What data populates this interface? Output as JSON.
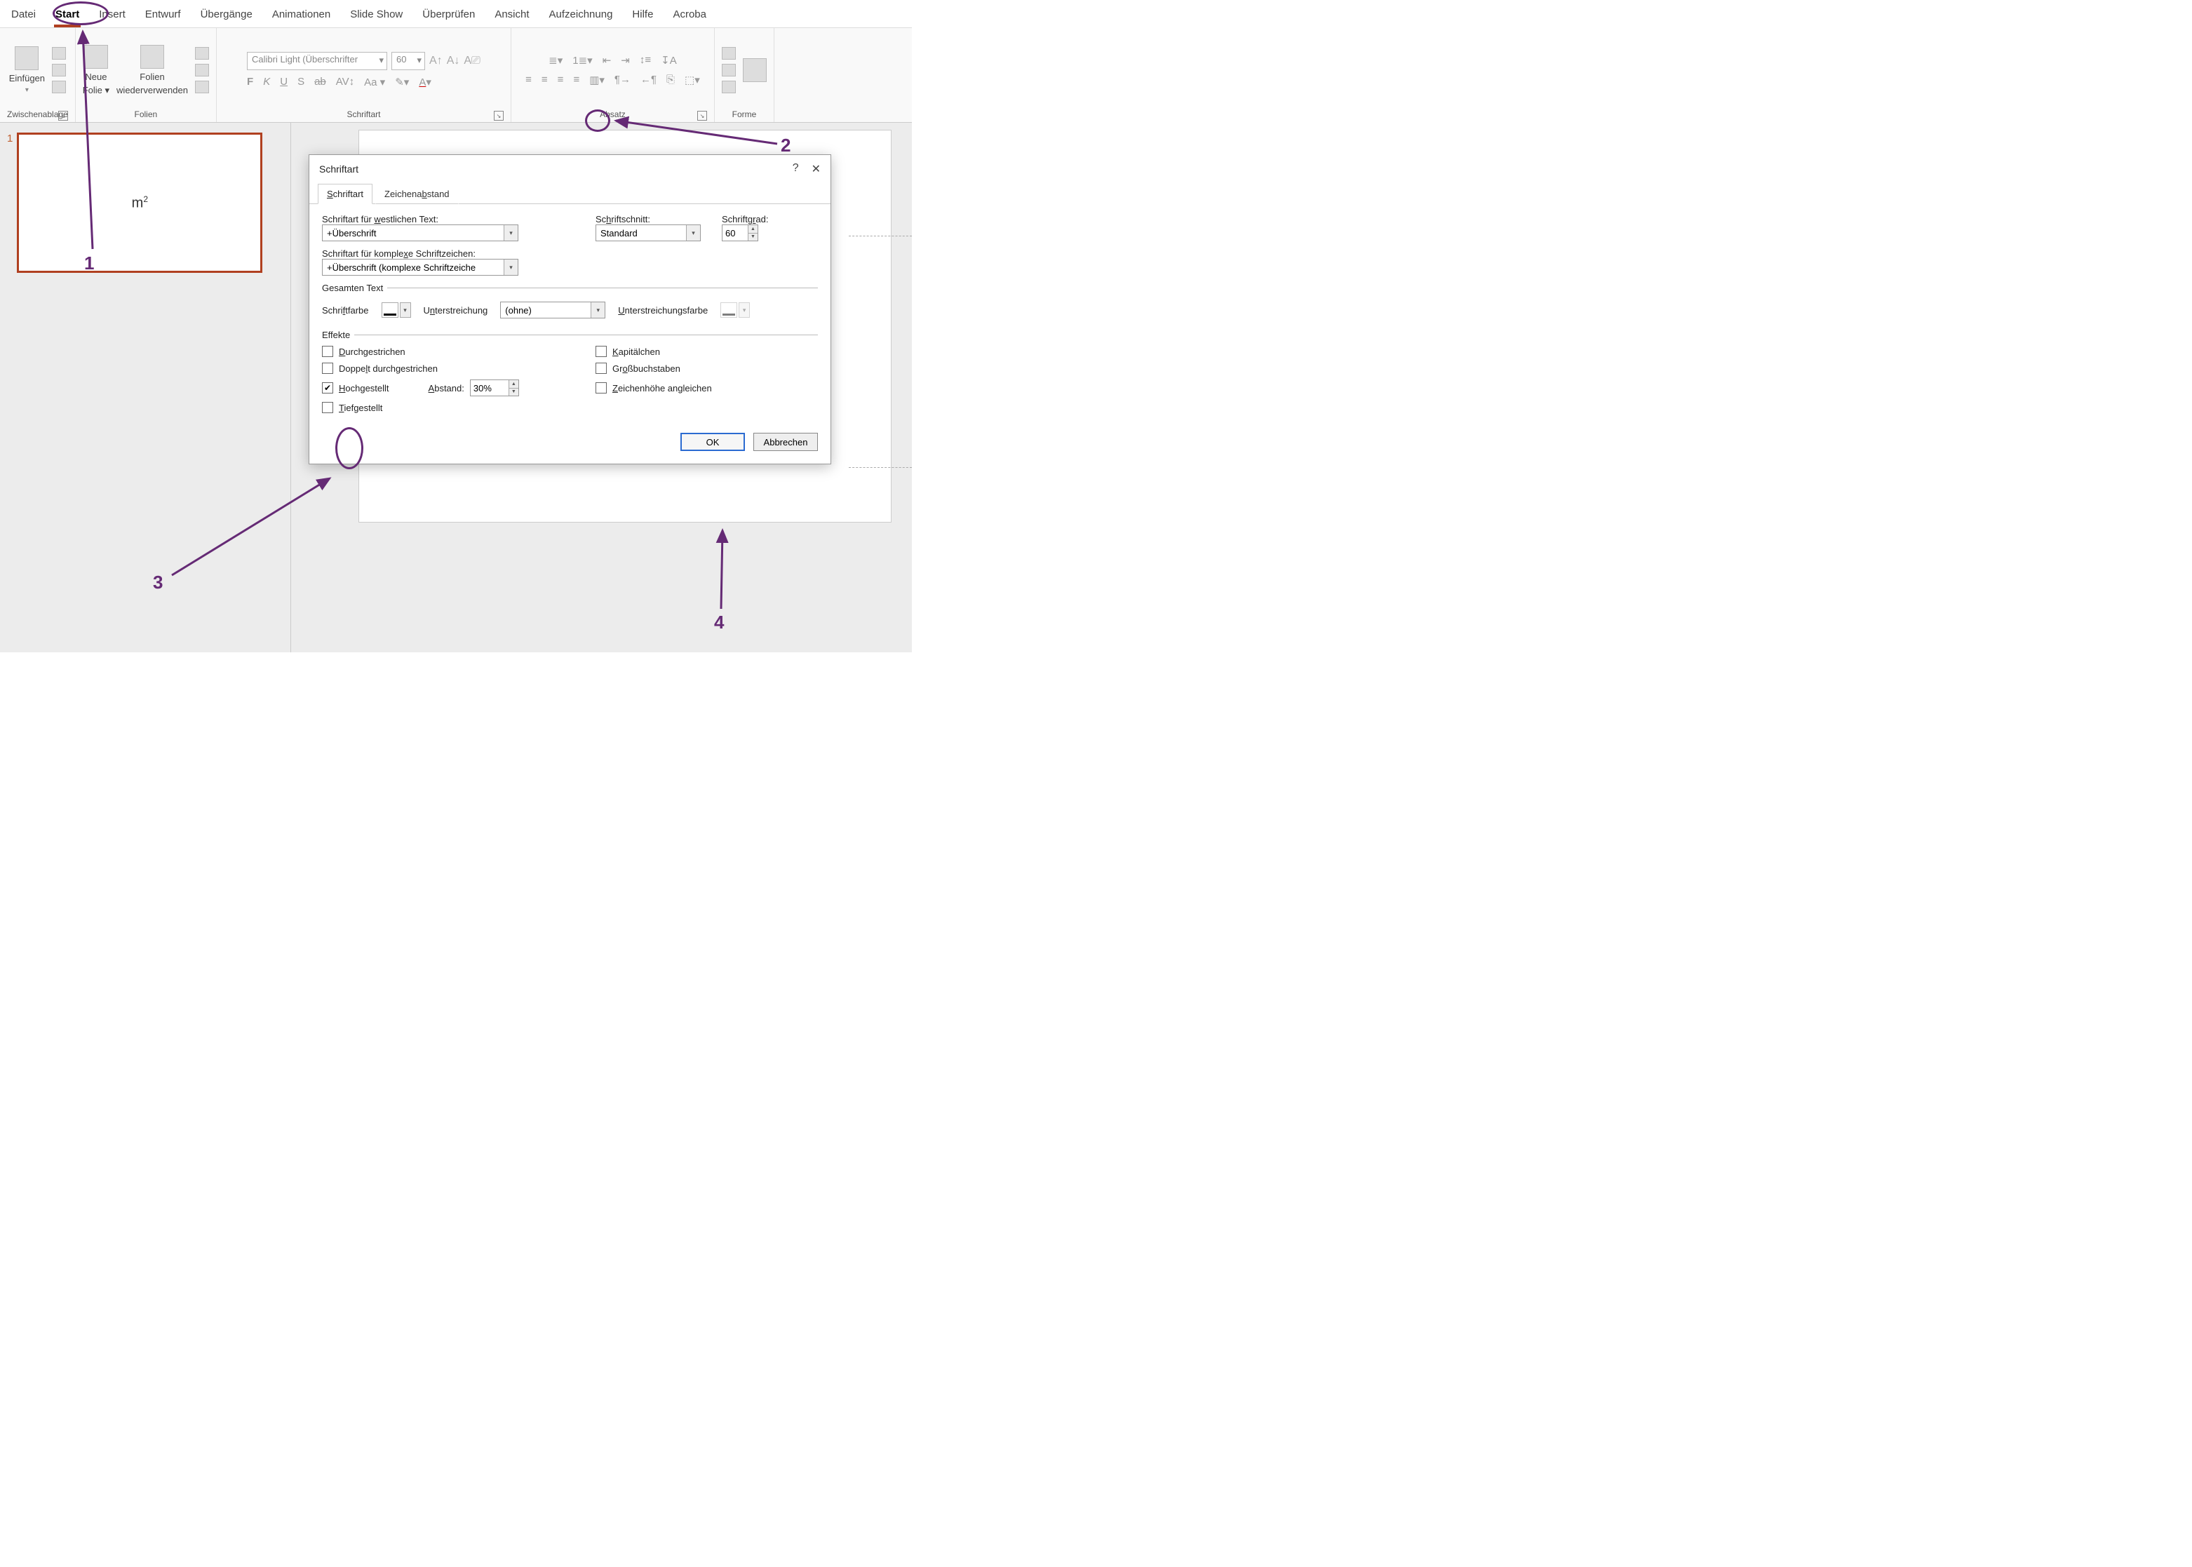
{
  "tabs": {
    "datei": "Datei",
    "start": "Start",
    "insert": "Insert",
    "entwurf": "Entwurf",
    "uebergaenge": "Übergänge",
    "animationen": "Animationen",
    "slideshow": "Slide Show",
    "ueberpruefen": "Überprüfen",
    "ansicht": "Ansicht",
    "aufzeichnung": "Aufzeichnung",
    "hilfe": "Hilfe",
    "acrobat": "Acroba"
  },
  "ribbon": {
    "clipboard": {
      "paste": "Einfügen",
      "label": "Zwischenablage"
    },
    "slides": {
      "new_slide": "Neue",
      "new_slide2": "Folie",
      "reuse": "Folien",
      "reuse2": "wiederverwenden",
      "label": "Folien"
    },
    "font": {
      "font_name": "Calibri Light (Überschrifter",
      "font_size": "60",
      "label": "Schriftart"
    },
    "paragraph": {
      "label": "Absatz"
    },
    "drawing": {
      "label": "Forme"
    }
  },
  "thumb": {
    "number": "1",
    "text_base": "m",
    "text_sup": "2"
  },
  "dialog": {
    "title": "Schriftart",
    "help": "?",
    "close": "✕",
    "tab_font": "Schriftart",
    "tab_spacing": "Zeichenabstand",
    "western_label": "Schriftart für westlichen Text:",
    "western_value": "+Überschrift",
    "style_label": "Schriftschnitt:",
    "style_value": "Standard",
    "size_label": "Schriftgrad:",
    "size_value": "60",
    "complex_label": "Schriftart für komplexe Schriftzeichen:",
    "complex_value": "+Überschrift (komplexe Schriftzeiche",
    "alltext_legend": "Gesamten Text",
    "fontcolor_label": "Schriftfarbe",
    "underline_label": "Unterstreichung",
    "underline_value": "(ohne)",
    "underline_color_label": "Unterstreichungsfarbe",
    "effects_legend": "Effekte",
    "strike": "Durchgestrichen",
    "dstrike": "Doppelt durchgestrichen",
    "superscript": "Hochgestellt",
    "subscript": "Tiefgestellt",
    "offset_label": "Abstand:",
    "offset_value": "30%",
    "smallcaps": "Kapitälchen",
    "allcaps": "Großbuchstaben",
    "equalize": "Zeichenhöhe angleichen",
    "ok": "OK",
    "cancel": "Abbrechen"
  },
  "annotation": {
    "n1": "1",
    "n2": "2",
    "n3": "3",
    "n4": "4"
  }
}
